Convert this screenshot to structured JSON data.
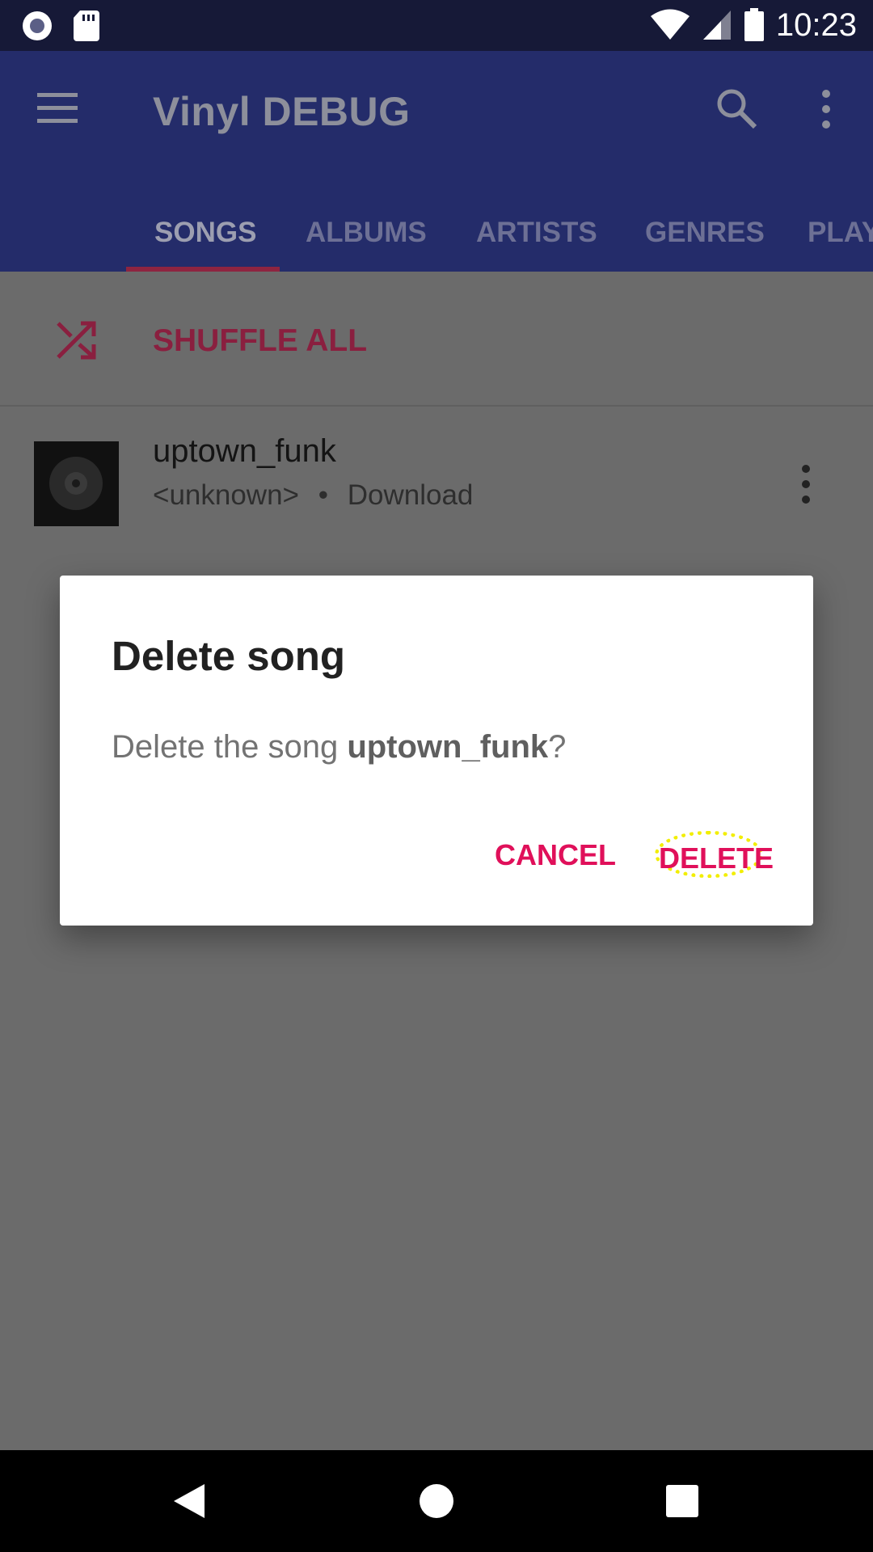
{
  "status_bar": {
    "time": "10:23",
    "icons": [
      "circle-notification-icon",
      "sd-card-icon",
      "wifi-icon",
      "cell-signal-icon",
      "battery-icon"
    ]
  },
  "app_bar": {
    "title": "Vinyl DEBUG",
    "icons": [
      "menu-icon",
      "search-icon",
      "more-vertical-icon"
    ],
    "background": "#242c6a"
  },
  "tabs": [
    {
      "label": "SONGS",
      "active": true
    },
    {
      "label": "ALBUMS",
      "active": false
    },
    {
      "label": "ARTISTS",
      "active": false
    },
    {
      "label": "GENRES",
      "active": false
    },
    {
      "label": "PLAY",
      "active": false
    }
  ],
  "shuffle": {
    "label": "SHUFFLE ALL",
    "icon": "shuffle-icon"
  },
  "songs": [
    {
      "title": "uptown_funk",
      "artist": "<unknown>",
      "separator": "•",
      "album": "Download"
    }
  ],
  "dialog": {
    "title": "Delete song",
    "message_prefix": "Delete the song ",
    "message_song": "uptown_funk",
    "message_suffix": "?",
    "cancel_label": "CANCEL",
    "delete_label": "DELETE",
    "accent_color": "#e0105a"
  },
  "nav_bar": {
    "icons": [
      "back-icon",
      "home-icon",
      "recents-icon"
    ]
  }
}
